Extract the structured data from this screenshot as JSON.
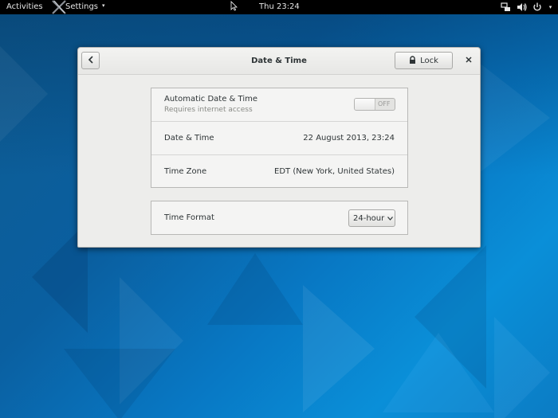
{
  "topbar": {
    "activities": "Activities",
    "app_menu": "Settings",
    "app_menu_arrow": "▾",
    "clock": "Thu 23:24",
    "tray_icons": [
      "network-icon",
      "volume-icon",
      "power-icon"
    ]
  },
  "dialog": {
    "title": "Date & Time",
    "back_icon": "chevron-left-icon",
    "lock_label": "Lock",
    "close_icon": "close-icon"
  },
  "settings": {
    "rows": [
      {
        "label": "Automatic Date & Time",
        "sublabel": "Requires internet access",
        "switch_text": "OFF",
        "switch_on": false
      },
      {
        "label": "Date & Time",
        "value": "22 August 2013, 23:24"
      },
      {
        "label": "Time Zone",
        "value": "EDT (New York, United States)"
      }
    ],
    "time_format": {
      "label": "Time Format",
      "selected": "24-hour"
    }
  },
  "colors": {
    "topbar": "#000000",
    "dialog_bg": "#ededeb",
    "desktop_blue": "#0a78c4"
  }
}
